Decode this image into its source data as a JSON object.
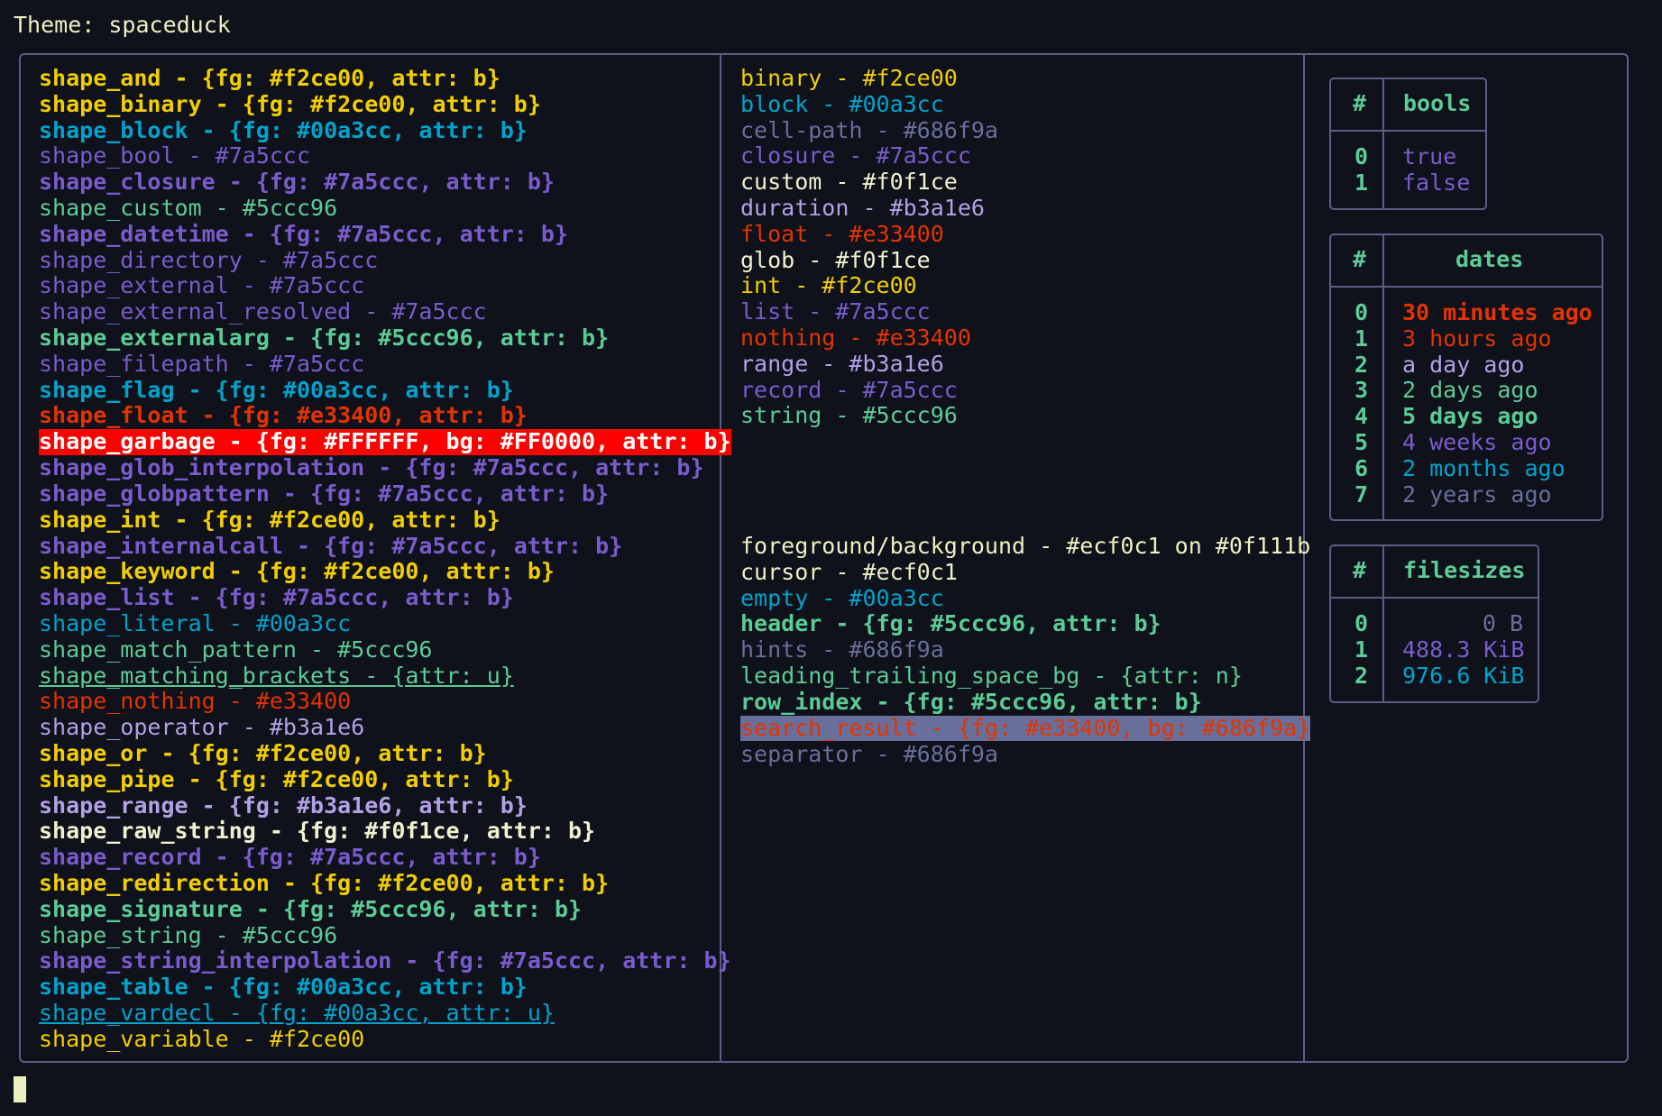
{
  "title": "Theme: spaceduck",
  "shapes": [
    {
      "text": "shape_and - {fg: #f2ce00, attr: b}",
      "color": "#f2ce00",
      "bold": true
    },
    {
      "text": "shape_binary - {fg: #f2ce00, attr: b}",
      "color": "#f2ce00",
      "bold": true
    },
    {
      "text": "shape_block - {fg: #00a3cc, attr: b}",
      "color": "#00a3cc",
      "bold": true
    },
    {
      "text": "shape_bool - #7a5ccc",
      "color": "#7a5ccc"
    },
    {
      "text": "shape_closure - {fg: #7a5ccc, attr: b}",
      "color": "#7a5ccc",
      "bold": true
    },
    {
      "text": "shape_custom - #5ccc96",
      "color": "#5ccc96"
    },
    {
      "text": "shape_datetime - {fg: #7a5ccc, attr: b}",
      "color": "#7a5ccc",
      "bold": true
    },
    {
      "text": "shape_directory - #7a5ccc",
      "color": "#7a5ccc"
    },
    {
      "text": "shape_external - #7a5ccc",
      "color": "#7a5ccc"
    },
    {
      "text": "shape_external_resolved - #7a5ccc",
      "color": "#7a5ccc"
    },
    {
      "text": "shape_externalarg - {fg: #5ccc96, attr: b}",
      "color": "#5ccc96",
      "bold": true
    },
    {
      "text": "shape_filepath - #7a5ccc",
      "color": "#7a5ccc"
    },
    {
      "text": "shape_flag - {fg: #00a3cc, attr: b}",
      "color": "#00a3cc",
      "bold": true
    },
    {
      "text": "shape_float - {fg: #e33400, attr: b}",
      "color": "#e33400",
      "bold": true
    },
    {
      "text": "shape_garbage - {fg: #FFFFFF, bg: #FF0000, attr: b}",
      "color": "#FFFFFF",
      "bg": "#FF0000",
      "bold": true
    },
    {
      "text": "shape_glob_interpolation - {fg: #7a5ccc, attr: b}",
      "color": "#7a5ccc",
      "bold": true
    },
    {
      "text": "shape_globpattern - {fg: #7a5ccc, attr: b}",
      "color": "#7a5ccc",
      "bold": true
    },
    {
      "text": "shape_int - {fg: #f2ce00, attr: b}",
      "color": "#f2ce00",
      "bold": true
    },
    {
      "text": "shape_internalcall - {fg: #7a5ccc, attr: b}",
      "color": "#7a5ccc",
      "bold": true
    },
    {
      "text": "shape_keyword - {fg: #f2ce00, attr: b}",
      "color": "#f2ce00",
      "bold": true
    },
    {
      "text": "shape_list - {fg: #7a5ccc, attr: b}",
      "color": "#7a5ccc",
      "bold": true
    },
    {
      "text": "shape_literal - #00a3cc",
      "color": "#00a3cc"
    },
    {
      "text": "shape_match_pattern - #5ccc96",
      "color": "#5ccc96"
    },
    {
      "text": "shape_matching_brackets - {attr: u}",
      "color": "#5ccc96",
      "underline": true
    },
    {
      "text": "shape_nothing - #e33400",
      "color": "#e33400"
    },
    {
      "text": "shape_operator - #b3a1e6",
      "color": "#b3a1e6"
    },
    {
      "text": "shape_or - {fg: #f2ce00, attr: b}",
      "color": "#f2ce00",
      "bold": true
    },
    {
      "text": "shape_pipe - {fg: #f2ce00, attr: b}",
      "color": "#f2ce00",
      "bold": true
    },
    {
      "text": "shape_range - {fg: #b3a1e6, attr: b}",
      "color": "#b3a1e6",
      "bold": true
    },
    {
      "text": "shape_raw_string - {fg: #f0f1ce, attr: b}",
      "color": "#f0f1ce",
      "bold": true
    },
    {
      "text": "shape_record - {fg: #7a5ccc, attr: b}",
      "color": "#7a5ccc",
      "bold": true
    },
    {
      "text": "shape_redirection - {fg: #f2ce00, attr: b}",
      "color": "#f2ce00",
      "bold": true
    },
    {
      "text": "shape_signature - {fg: #5ccc96, attr: b}",
      "color": "#5ccc96",
      "bold": true
    },
    {
      "text": "shape_string - #5ccc96",
      "color": "#5ccc96"
    },
    {
      "text": "shape_string_interpolation - {fg: #7a5ccc, attr: b}",
      "color": "#7a5ccc",
      "bold": true
    },
    {
      "text": "shape_table - {fg: #00a3cc, attr: b}",
      "color": "#00a3cc",
      "bold": true
    },
    {
      "text": "shape_vardecl - {fg: #00a3cc, attr: u}",
      "color": "#00a3cc",
      "underline": true
    },
    {
      "text": "shape_variable - #f2ce00",
      "color": "#f2ce00"
    }
  ],
  "types": [
    {
      "text": "binary - #f2ce00",
      "color": "#f2ce00"
    },
    {
      "text": "block - #00a3cc",
      "color": "#00a3cc"
    },
    {
      "text": "cell-path - #686f9a",
      "color": "#686f9a"
    },
    {
      "text": "closure - #7a5ccc",
      "color": "#7a5ccc"
    },
    {
      "text": "custom - #f0f1ce",
      "color": "#f0f1ce"
    },
    {
      "text": "duration - #b3a1e6",
      "color": "#b3a1e6"
    },
    {
      "text": "float - #e33400",
      "color": "#e33400"
    },
    {
      "text": "glob - #f0f1ce",
      "color": "#f0f1ce"
    },
    {
      "text": "int - #f2ce00",
      "color": "#f2ce00"
    },
    {
      "text": "list - #7a5ccc",
      "color": "#7a5ccc"
    },
    {
      "text": "nothing - #e33400",
      "color": "#e33400"
    },
    {
      "text": "range - #b3a1e6",
      "color": "#b3a1e6"
    },
    {
      "text": "record - #7a5ccc",
      "color": "#7a5ccc"
    },
    {
      "text": "string - #5ccc96",
      "color": "#5ccc96"
    }
  ],
  "ui": [
    {
      "text": "foreground/background - #ecf0c1 on #0f111b",
      "color": "#ecf0c1"
    },
    {
      "text": "cursor - #ecf0c1",
      "color": "#ecf0c1"
    },
    {
      "text": "empty - #00a3cc",
      "color": "#00a3cc"
    },
    {
      "text": "header - {fg: #5ccc96, attr: b}",
      "color": "#5ccc96",
      "bold": true
    },
    {
      "text": "hints - #686f9a",
      "color": "#686f9a"
    },
    {
      "text": "leading_trailing_space_bg - {attr: n}",
      "color": "#5ccc96"
    },
    {
      "text": "row_index - {fg: #5ccc96, attr: b}",
      "color": "#5ccc96",
      "bold": true
    },
    {
      "text": "search_result - {fg: #e33400, bg: #686f9a}",
      "color": "#e33400",
      "bg": "#686f9a"
    },
    {
      "text": "separator - #686f9a",
      "color": "#686f9a"
    }
  ],
  "bools": {
    "hash": "#",
    "header": "bools",
    "rows": [
      {
        "i": "0",
        "v": "true",
        "color": "#7a5ccc"
      },
      {
        "i": "1",
        "v": "false",
        "color": "#7a5ccc"
      }
    ]
  },
  "dates": {
    "hash": "#",
    "header": "dates",
    "rows": [
      {
        "i": "0",
        "v": "30 minutes ago",
        "color": "#e33400",
        "bold": true
      },
      {
        "i": "1",
        "v": "3 hours ago",
        "color": "#e33400"
      },
      {
        "i": "2",
        "v": "a day ago",
        "color": "#b3a1e6"
      },
      {
        "i": "3",
        "v": "2 days ago",
        "color": "#5ccc96"
      },
      {
        "i": "4",
        "v": "5 days ago",
        "color": "#5ccc96",
        "bold": true
      },
      {
        "i": "5",
        "v": "4 weeks ago",
        "color": "#7a5ccc"
      },
      {
        "i": "6",
        "v": "2 months ago",
        "color": "#00a3cc"
      },
      {
        "i": "7",
        "v": "2 years ago",
        "color": "#686f9a"
      }
    ]
  },
  "filesizes": {
    "hash": "#",
    "header": "filesizes",
    "rows": [
      {
        "i": "0",
        "v": "0 B",
        "color": "#686f9a"
      },
      {
        "i": "1",
        "v": "488.3 KiB",
        "color": "#7a5ccc"
      },
      {
        "i": "2",
        "v": "976.6 KiB",
        "color": "#00a3cc"
      }
    ]
  }
}
